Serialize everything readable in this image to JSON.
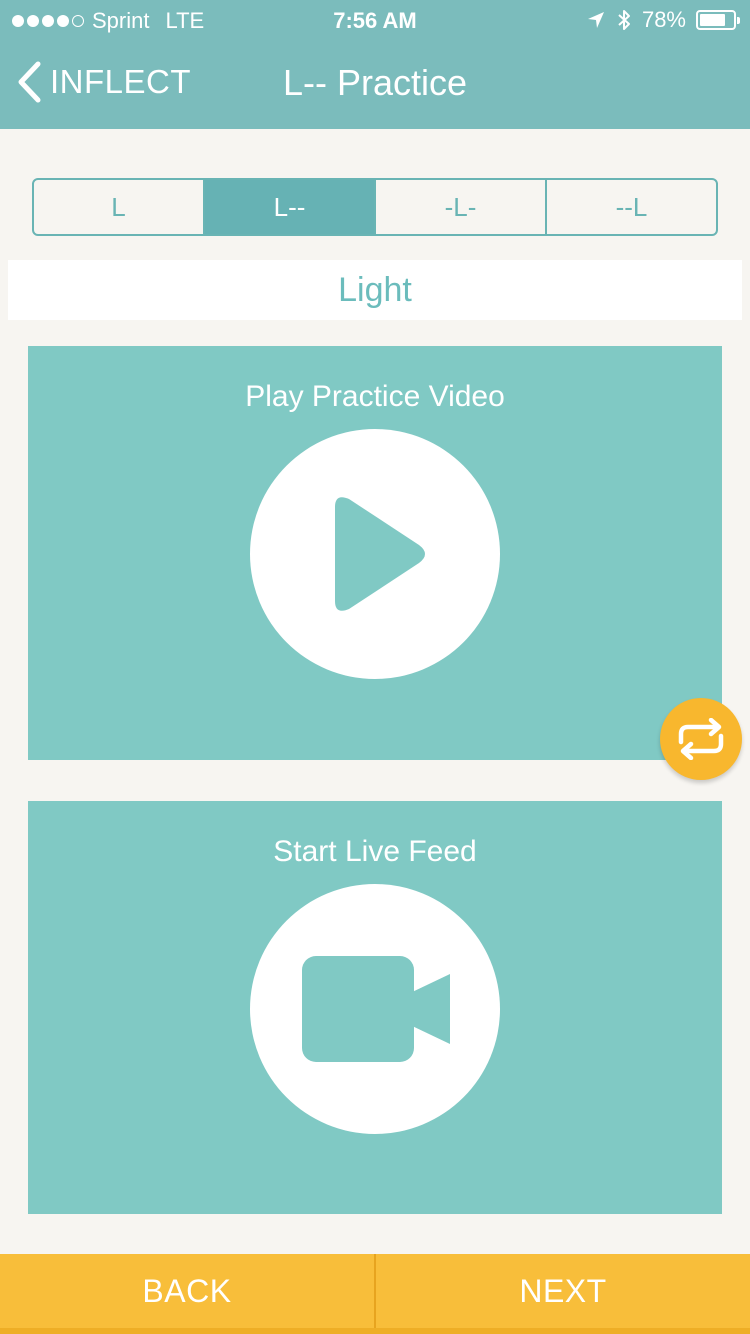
{
  "status_bar": {
    "carrier": "Sprint",
    "network": "LTE",
    "time": "7:56 AM",
    "battery": "78%",
    "battery_level": 0.78,
    "signal_bars_filled": 4,
    "signal_bars_total": 5
  },
  "nav": {
    "back_label": "INFLECT",
    "title": "L-- Practice"
  },
  "segments": {
    "items": [
      {
        "label": "L",
        "active": false
      },
      {
        "label": "L--",
        "active": true
      },
      {
        "label": "-L-",
        "active": false
      },
      {
        "label": "--L",
        "active": false
      }
    ]
  },
  "word": "Light",
  "cards": {
    "video_label": "Play Practice Video",
    "live_label": "Start Live Feed"
  },
  "bottom": {
    "back_label": "BACK",
    "next_label": "NEXT"
  },
  "colors": {
    "header": "#7bbcbc",
    "accent": "#69b4b4",
    "card": "#80c9c4",
    "button_bar": "#f8be3a",
    "fab": "#f8b72e",
    "background": "#f7f5f1"
  },
  "icons": {
    "back": "chevron-left-icon",
    "location": "location-arrow-icon",
    "bluetooth": "bluetooth-icon",
    "battery": "battery-icon",
    "play": "play-icon",
    "camera": "video-camera-icon",
    "repeat": "repeat-icon"
  }
}
